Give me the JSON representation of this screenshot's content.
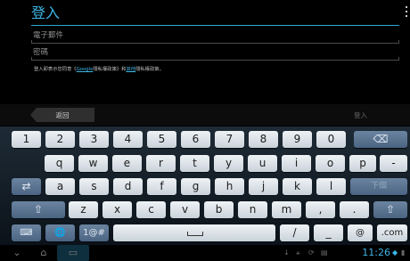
{
  "form": {
    "title": "登入",
    "email_placeholder": "電子郵件",
    "password_placeholder": "密碼",
    "terms_prefix": "登入即表示您同意《",
    "terms_link1": "Google",
    "terms_middle": "隱私權政策》和",
    "terms_link2": "其他",
    "terms_suffix": "隱私權政策。"
  },
  "actions": {
    "back_label": "返回",
    "login_label": "登入"
  },
  "keyboard": {
    "row1": [
      "1",
      "2",
      "3",
      "4",
      "5",
      "6",
      "7",
      "8",
      "9",
      "0"
    ],
    "row2": [
      "q",
      "w",
      "e",
      "r",
      "t",
      "y",
      "u",
      "i",
      "o",
      "p",
      "-"
    ],
    "row3": [
      "a",
      "s",
      "d",
      "f",
      "g",
      "h",
      "j",
      "k",
      "l"
    ],
    "row3_action": "下個",
    "row4": [
      "z",
      "x",
      "c",
      "v",
      "b",
      "n",
      "m",
      ",",
      "."
    ],
    "row5_symbols": "1@#",
    "row5_slash": "/",
    "row5_underscore": "_",
    "row5_at": "@",
    "row5_com": ".com",
    "backspace_glyph": "⌫",
    "tab_glyph": "⇄",
    "shift_glyph": "⇧",
    "settings_glyph": "⌨",
    "globe_glyph": "🌐"
  },
  "status": {
    "time": "11:26"
  }
}
